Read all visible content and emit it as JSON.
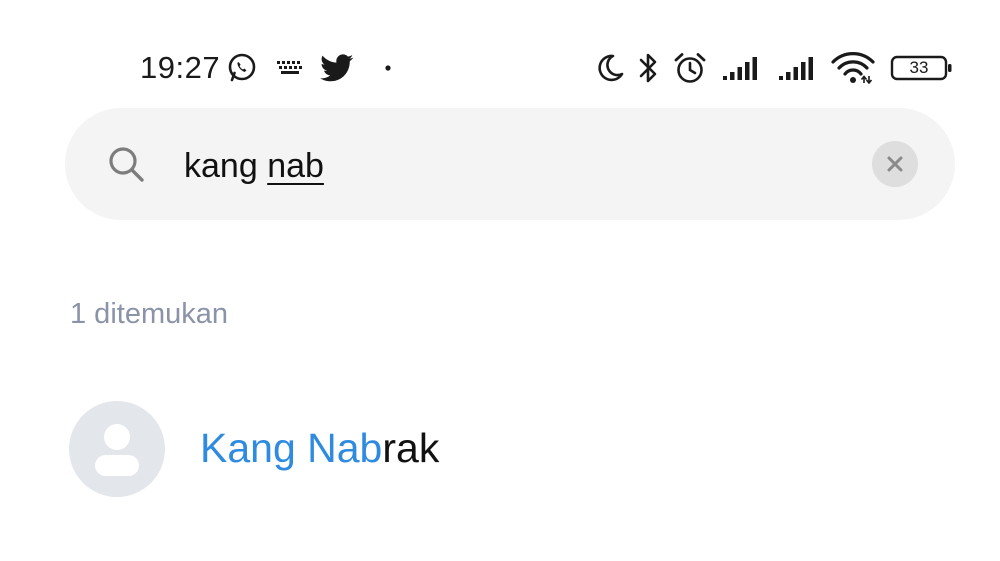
{
  "status_bar": {
    "time": "19:27",
    "left_icons": [
      "whatsapp-icon",
      "keyboard-icon",
      "twitter-icon",
      "notification-dot-icon"
    ],
    "right_icons": [
      "moon-icon",
      "bluetooth-icon",
      "alarm-icon",
      "signal-icon",
      "signal-icon",
      "wifi-icon",
      "battery-icon"
    ],
    "battery_level": "33"
  },
  "search": {
    "query_prefix": "kang ",
    "query_underlined": "nab",
    "clear_icon": "close-icon"
  },
  "results": {
    "count_text": "1 ditemukan",
    "contacts": [
      {
        "name_match": "Kang Nab",
        "name_rest": "rak",
        "avatar_icon": "person-icon"
      }
    ]
  },
  "colors": {
    "match_highlight": "#2f8be0",
    "count_text": "#8a93a8",
    "search_background": "#f4f4f4",
    "avatar_background": "#e3e6ea"
  }
}
